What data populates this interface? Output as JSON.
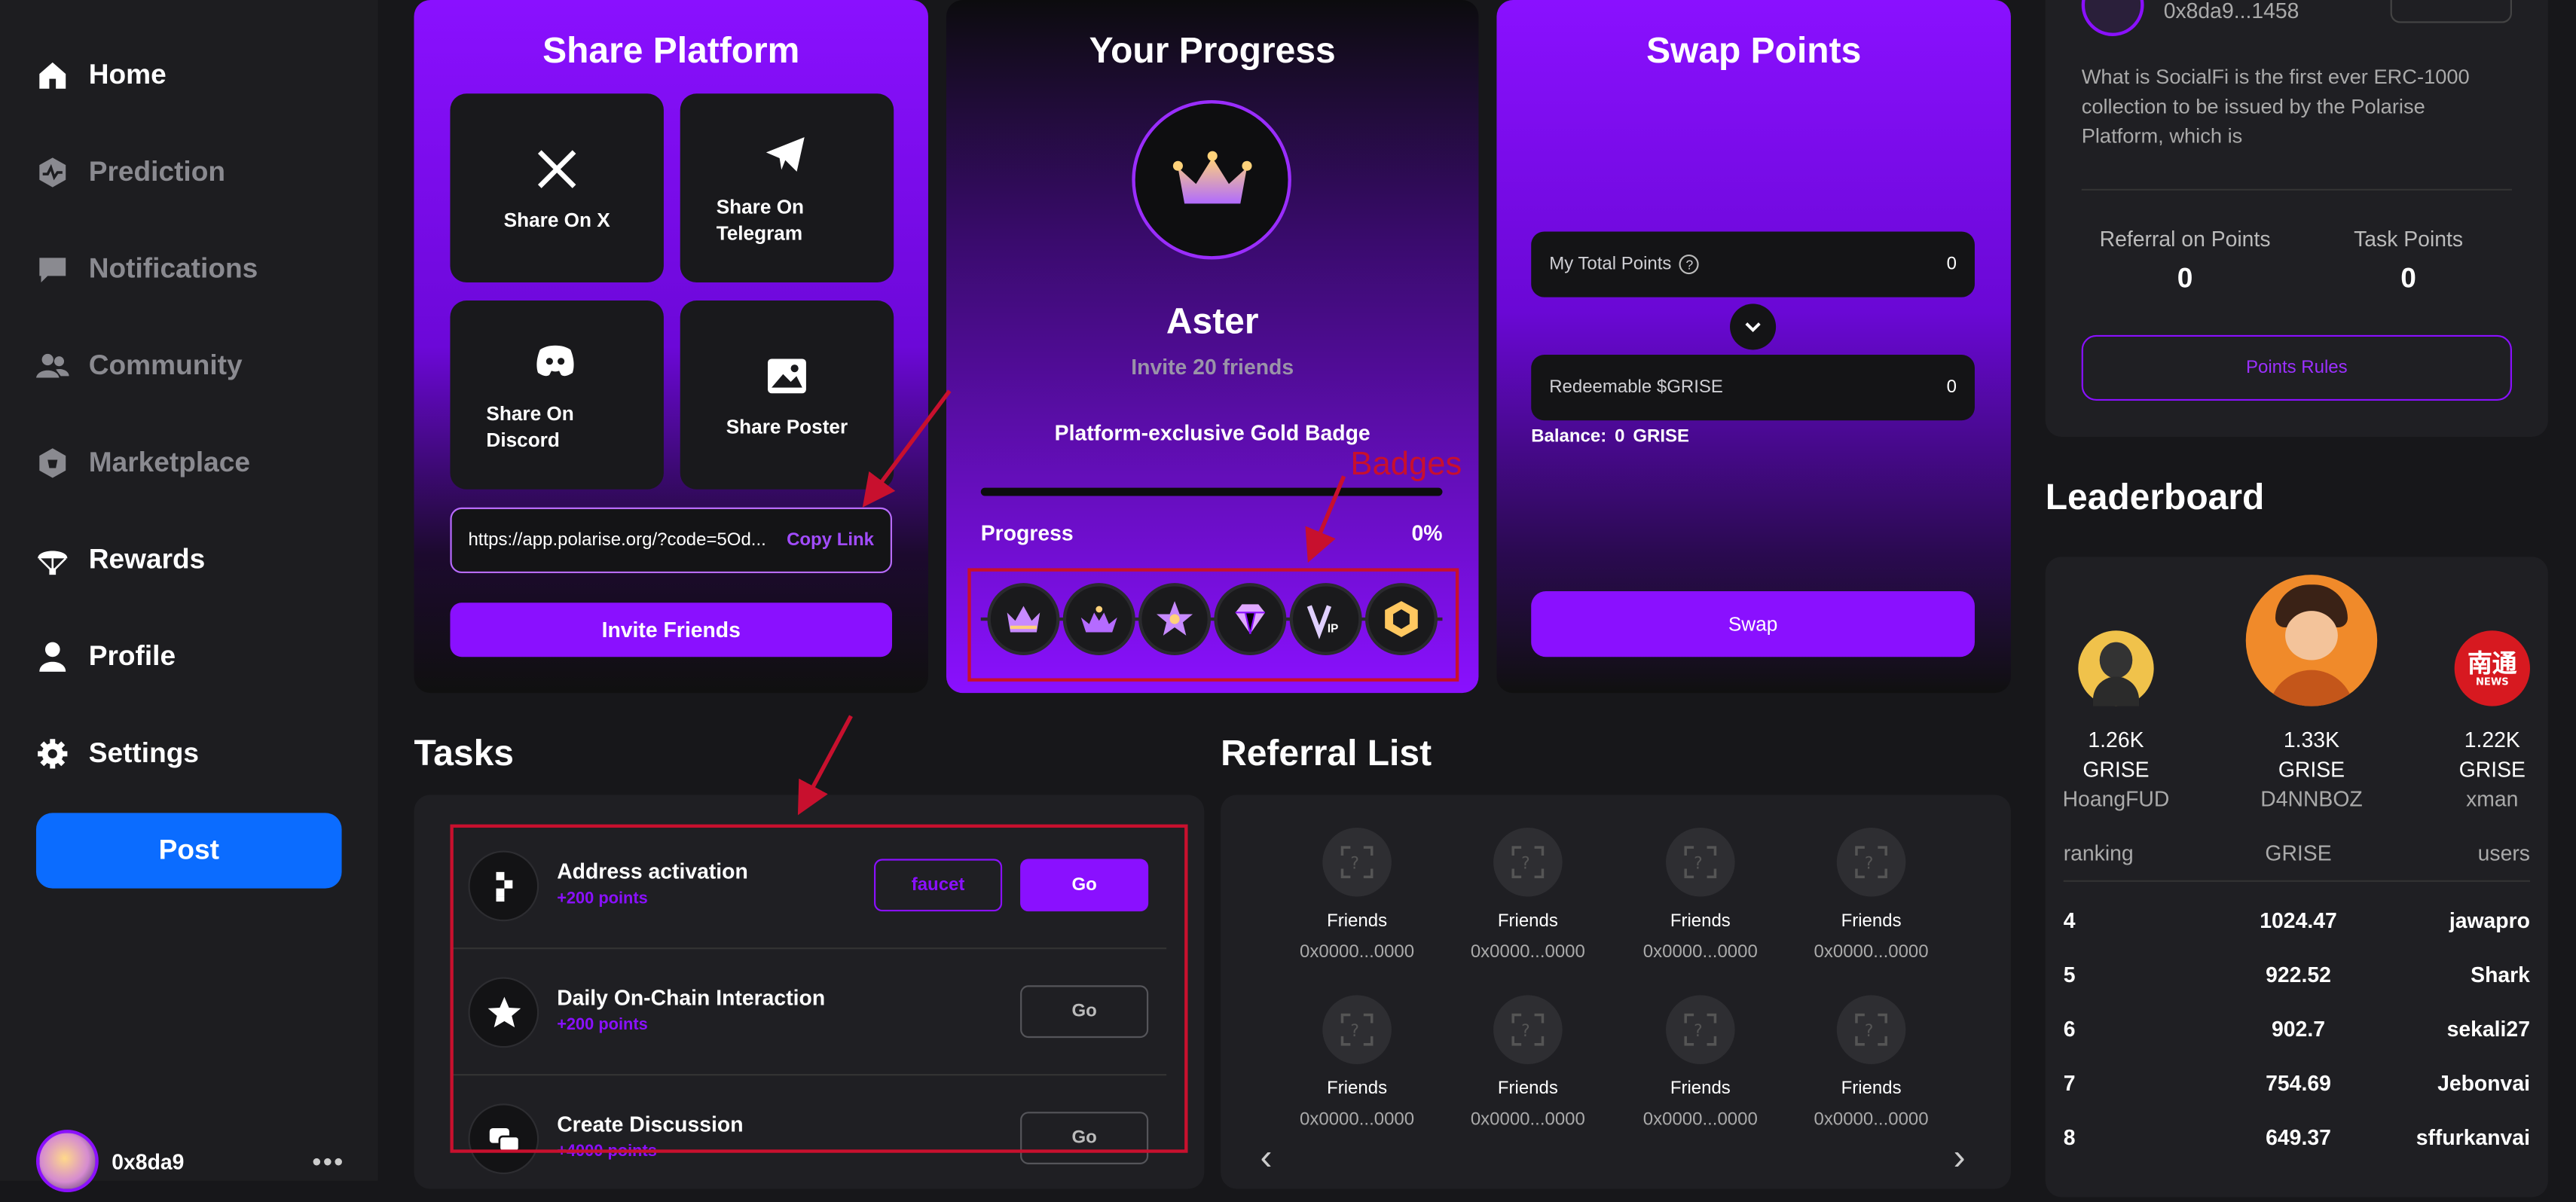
{
  "sidebar": {
    "items": [
      {
        "label": "Home",
        "icon": "home-icon"
      },
      {
        "label": "Prediction",
        "icon": "prediction-icon"
      },
      {
        "label": "Notifications",
        "icon": "chat-bubble-icon"
      },
      {
        "label": "Community",
        "icon": "users-icon"
      },
      {
        "label": "Marketplace",
        "icon": "shop-icon"
      },
      {
        "label": "Rewards",
        "icon": "parachute-icon"
      },
      {
        "label": "Profile",
        "icon": "person-icon"
      },
      {
        "label": "Settings",
        "icon": "gear-icon"
      }
    ],
    "post_label": "Post",
    "user_name": "0x8da9",
    "more_label": "•••"
  },
  "share_platform": {
    "title": "Share Platform",
    "tiles": [
      {
        "label": "Share On X",
        "icon": "x-logo-icon"
      },
      {
        "label": "Share On Telegram",
        "icon": "telegram-icon"
      },
      {
        "label": "Share On Discord",
        "icon": "discord-icon"
      },
      {
        "label": "Share Poster",
        "icon": "image-icon"
      }
    ],
    "link": "https://app.polarise.org/?code=5Od...",
    "copy_label": "Copy Link",
    "invite_label": "Invite Friends"
  },
  "progress": {
    "title": "Your Progress",
    "level_name": "Aster",
    "invite_text": "Invite 20 friends",
    "badge_text": "Platform-exclusive Gold Badge",
    "progress_label": "Progress",
    "progress_value": "0%",
    "progress_fraction": 0,
    "badges": [
      "crown-badge-icon",
      "tiara-badge-icon",
      "star-badge-icon",
      "diamond-badge-icon",
      "vip-badge-icon",
      "hexagon-badge-icon"
    ]
  },
  "swap": {
    "title": "Swap Points",
    "total_label": "My Total Points",
    "total_value": "0",
    "redeem_label": "Redeemable $GRISE",
    "redeem_value": "0",
    "balance_label": "Balance:",
    "balance_value": "0",
    "balance_unit": "GRISE",
    "swap_label": "Swap"
  },
  "tasks": {
    "title": "Tasks",
    "items": [
      {
        "name": "Address activation",
        "points": "+200 points",
        "extra": "faucet",
        "go": "Go",
        "icon": "pixel-logo-icon"
      },
      {
        "name": "Daily On-Chain Interaction",
        "points": "+200 points",
        "go": "Go",
        "icon": "star-icon"
      },
      {
        "name": "Create Discussion",
        "points": "+4000 points",
        "go": "Go",
        "icon": "discussion-icon"
      }
    ]
  },
  "referral": {
    "title": "Referral List",
    "friends": [
      {
        "name": "Friends",
        "addr": "0x0000...0000"
      },
      {
        "name": "Friends",
        "addr": "0x0000...0000"
      },
      {
        "name": "Friends",
        "addr": "0x0000...0000"
      },
      {
        "name": "Friends",
        "addr": "0x0000...0000"
      },
      {
        "name": "Friends",
        "addr": "0x0000...0000"
      },
      {
        "name": "Friends",
        "addr": "0x0000...0000"
      },
      {
        "name": "Friends",
        "addr": "0x0000...0000"
      },
      {
        "name": "Friends",
        "addr": "0x0000...0000"
      }
    ],
    "prev": "‹",
    "next": "›"
  },
  "profile_card": {
    "address": "0x8da9...1458",
    "description": "What is SocialFi is the first ever ERC-1000 collection to be issued by the Polarise Platform, which is",
    "referral_label": "Referral on Points",
    "referral_value": "0",
    "task_label": "Task Points",
    "task_value": "0",
    "rules_label": "Points Rules"
  },
  "leaderboard": {
    "title": "Leaderboard",
    "top3": [
      {
        "value": "1.26K",
        "unit": "GRISE",
        "name": "HoangFUD"
      },
      {
        "value": "1.33K",
        "unit": "GRISE",
        "name": "D4NNBOZ"
      },
      {
        "value": "1.22K",
        "unit": "GRISE",
        "name": "xman"
      }
    ],
    "headers": [
      "ranking",
      "GRISE",
      "users"
    ],
    "rows": [
      {
        "rank": "4",
        "grise": "1024.47",
        "user": "jawapro"
      },
      {
        "rank": "5",
        "grise": "922.52",
        "user": "Shark"
      },
      {
        "rank": "6",
        "grise": "902.7",
        "user": "sekali27"
      },
      {
        "rank": "7",
        "grise": "754.69",
        "user": "Jebonvai"
      },
      {
        "rank": "8",
        "grise": "649.37",
        "user": "sffurkanvai"
      }
    ]
  },
  "annotations": {
    "badges_label": "Badges",
    "color": "#c8102e"
  },
  "colors": {
    "accent": "#8a10ff",
    "post": "#0b6cff",
    "bg": "#17171a"
  }
}
